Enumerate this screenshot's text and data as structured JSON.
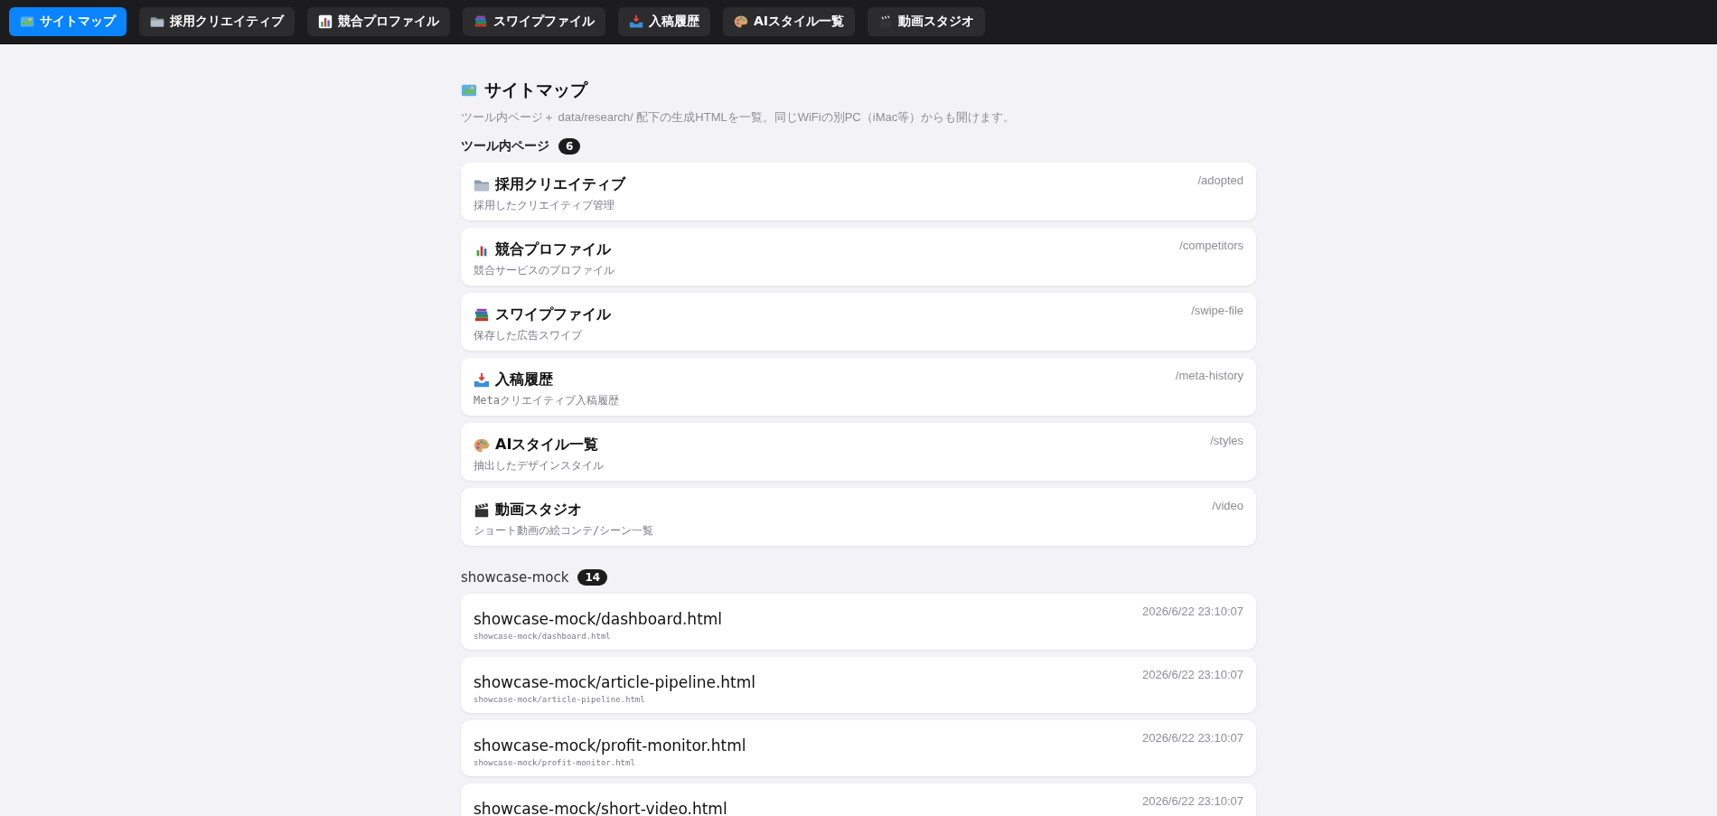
{
  "nav": [
    {
      "label": "サイトマップ",
      "selected": true
    },
    {
      "label": "採用クリエイティブ",
      "selected": false
    },
    {
      "label": "競合プロファイル",
      "selected": false
    },
    {
      "label": "スワイプファイル",
      "selected": false
    },
    {
      "label": "入稿履歴",
      "selected": false
    },
    {
      "label": "AIスタイル一覧",
      "selected": false
    },
    {
      "label": "動画スタジオ",
      "selected": false
    }
  ],
  "page": {
    "title": "サイトマップ",
    "description": "ツール内ページ＋ data/research/ 配下の生成HTMLを一覧。同じWiFiの別PC（iMac等）からも開けます。"
  },
  "sections": [
    {
      "heading": "ツール内ページ",
      "count": "6",
      "kind": "tool",
      "items": [
        {
          "title": "採用クリエイティブ",
          "subtitle": "採用したクリエイティブ管理",
          "meta": "/adopted"
        },
        {
          "title": "競合プロファイル",
          "subtitle": "競合サービスのプロファイル",
          "meta": "/competitors"
        },
        {
          "title": "スワイプファイル",
          "subtitle": "保存した広告スワイプ",
          "meta": "/swipe-file"
        },
        {
          "title": "入稿履歴",
          "subtitle": "Metaクリエイティブ入稿履歴",
          "meta": "/meta-history"
        },
        {
          "title": "AIスタイル一覧",
          "subtitle": "抽出したデザインスタイル",
          "meta": "/styles"
        },
        {
          "title": "動画スタジオ",
          "subtitle": "ショート動画の絵コンテ/シーン一覧",
          "meta": "/video"
        }
      ]
    },
    {
      "heading": "showcase-mock",
      "count": "14",
      "kind": "file",
      "items": [
        {
          "title": "showcase-mock/dashboard.html",
          "subtitle": "showcase-mock/dashboard.html",
          "meta": "2026/6/22 23:10:07"
        },
        {
          "title": "showcase-mock/article-pipeline.html",
          "subtitle": "showcase-mock/article-pipeline.html",
          "meta": "2026/6/22 23:10:07"
        },
        {
          "title": "showcase-mock/profit-monitor.html",
          "subtitle": "showcase-mock/profit-monitor.html",
          "meta": "2026/6/22 23:10:07"
        },
        {
          "title": "showcase-mock/short-video.html",
          "meta": "2026/6/22 23:10:07"
        }
      ]
    }
  ]
}
